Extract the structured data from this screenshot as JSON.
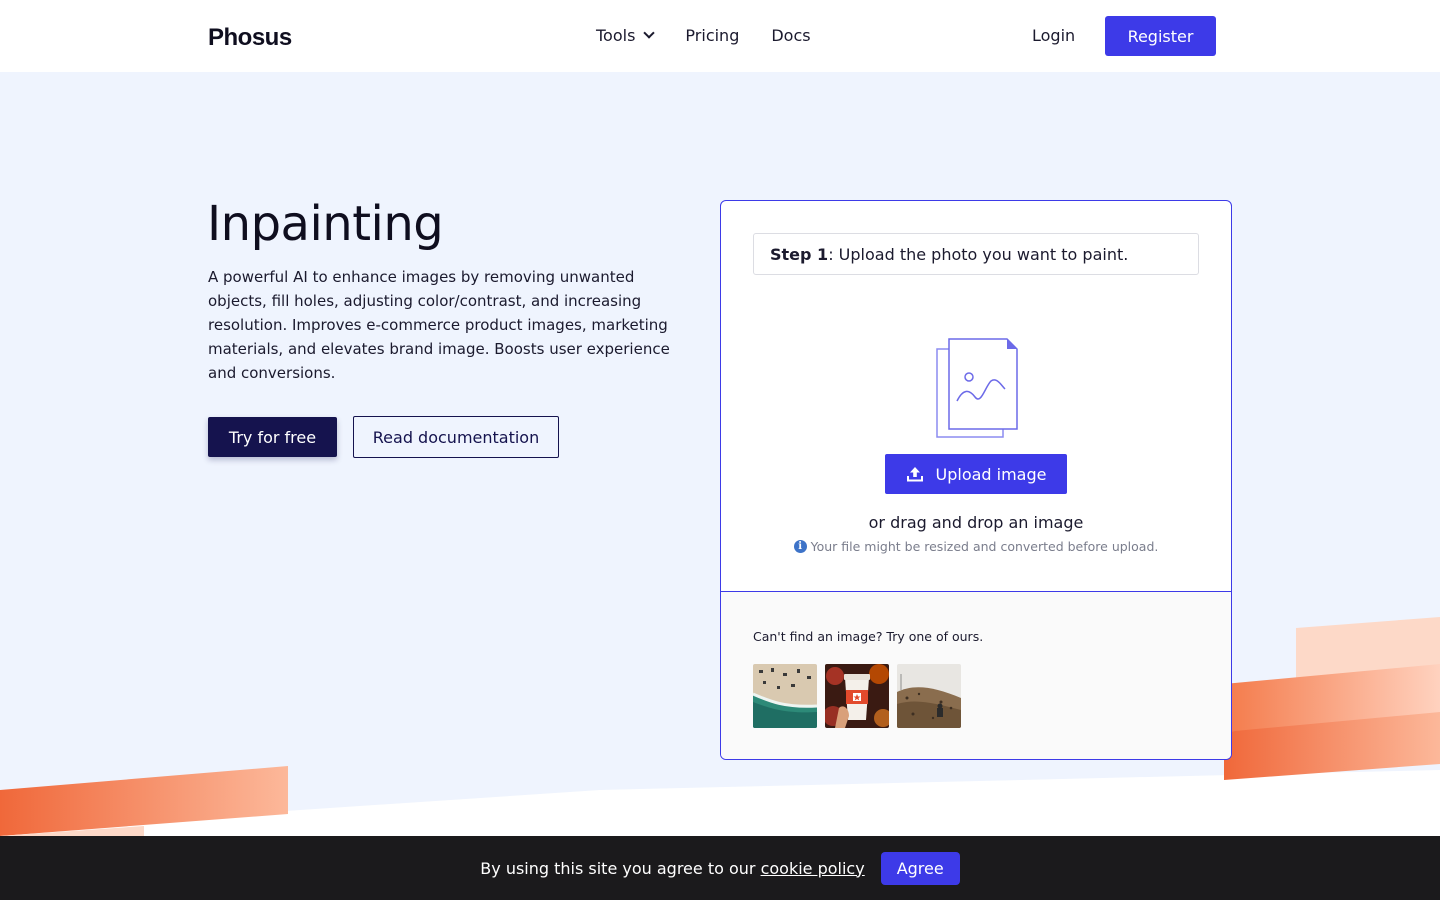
{
  "header": {
    "logo": "Phosus",
    "nav": [
      {
        "label": "Tools",
        "has_dropdown": true
      },
      {
        "label": "Pricing"
      },
      {
        "label": "Docs"
      }
    ],
    "login_label": "Login",
    "register_label": "Register"
  },
  "hero": {
    "title": "Inpainting",
    "description": "A powerful AI to enhance images by removing unwanted objects, fill holes, adjusting color/contrast, and increasing resolution. Improves e-commerce product images, marketing materials, and elevates brand image. Boosts user experience and conversions.",
    "try_label": "Try for free",
    "docs_label": "Read documentation"
  },
  "upload": {
    "step_prefix": "Step 1",
    "step_text": ": Upload the photo you want to paint.",
    "upload_label": "Upload image",
    "drag_text": "or drag and drop an image",
    "hint": "Your file might be resized and converted before upload.",
    "samples_title": "Can't find an image? Try one of ours.",
    "samples": [
      "beach-aerial-sample",
      "coffee-cup-sample",
      "rocky-hill-sample"
    ]
  },
  "cookie": {
    "text": "By using this site you agree to our",
    "link": "cookie policy",
    "agree_label": "Agree"
  },
  "colors": {
    "accent": "#3d3ae8",
    "dark_button": "#15134e",
    "hero_bg": "#eff4fe",
    "orange": "#f26b3a"
  }
}
